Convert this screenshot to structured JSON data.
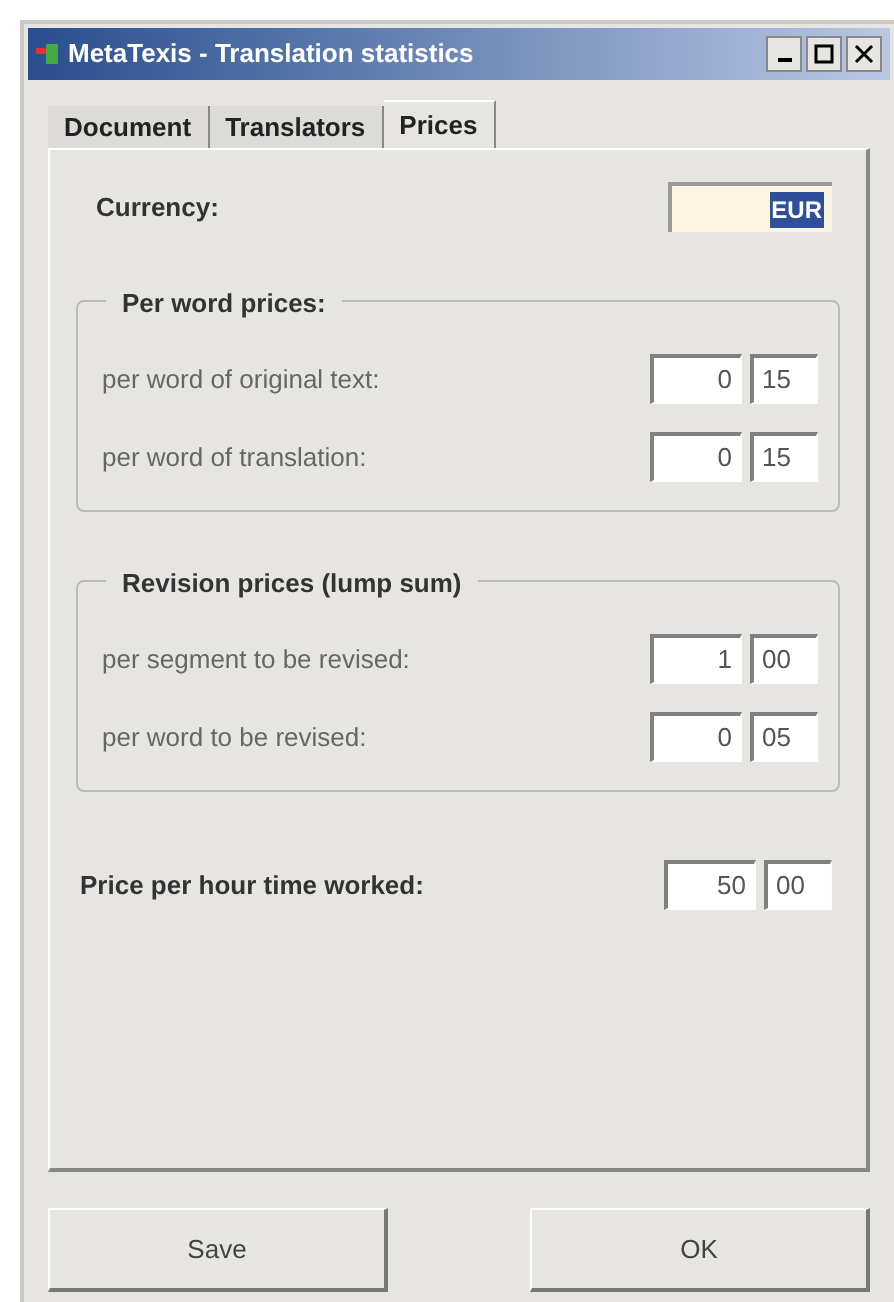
{
  "window": {
    "title": "MetaTexis - Translation statistics"
  },
  "tabs": [
    {
      "label": "Document",
      "selected": false
    },
    {
      "label": "Translators",
      "selected": false
    },
    {
      "label": "Prices",
      "selected": true
    }
  ],
  "currency": {
    "label": "Currency:",
    "value": "EUR"
  },
  "groups": [
    {
      "title": "Per word prices:",
      "rows": [
        {
          "label": "per word of original text:",
          "integer": "0",
          "decimal": "15"
        },
        {
          "label": "per word of translation:",
          "integer": "0",
          "decimal": "15"
        }
      ]
    },
    {
      "title": "Revision prices (lump sum)",
      "rows": [
        {
          "label": "per segment to be revised:",
          "integer": "1",
          "decimal": "00"
        },
        {
          "label": "per word to be revised:",
          "integer": "0",
          "decimal": "05"
        }
      ]
    }
  ],
  "hourly": {
    "label": "Price per hour time worked:",
    "integer": "50",
    "decimal": "00"
  },
  "buttons": [
    "Save",
    "OK"
  ]
}
